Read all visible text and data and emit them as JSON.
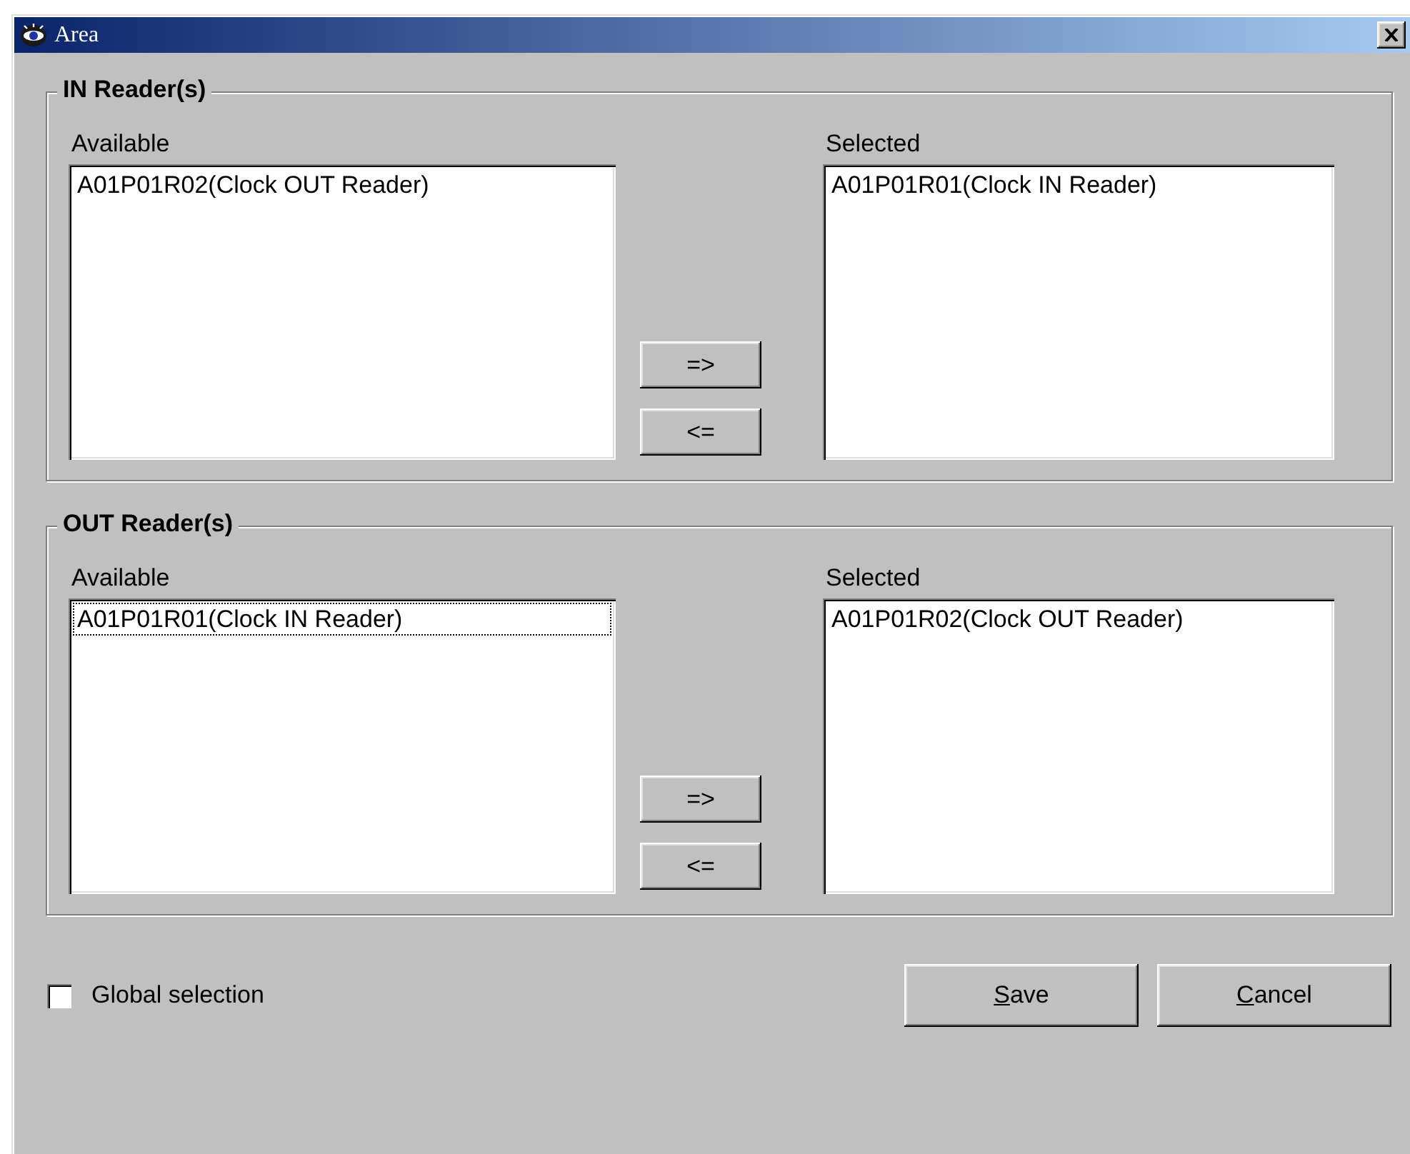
{
  "window": {
    "title": "Area"
  },
  "groups": [
    {
      "title": "IN Reader(s)",
      "available": {
        "label": "Available",
        "items": [
          {
            "text": "A01P01R02(Clock OUT Reader)",
            "focused": false
          }
        ]
      },
      "selected": {
        "label": "Selected",
        "items": [
          {
            "text": "A01P01R01(Clock IN Reader)",
            "focused": false
          }
        ]
      },
      "buttons": [
        "=>",
        "<="
      ]
    },
    {
      "title": "OUT Reader(s)",
      "available": {
        "label": "Available",
        "items": [
          {
            "text": "A01P01R01(Clock IN Reader)",
            "focused": true
          }
        ]
      },
      "selected": {
        "label": "Selected",
        "items": [
          {
            "text": "A01P01R02(Clock OUT Reader)",
            "focused": false
          }
        ]
      },
      "buttons": [
        "=>",
        "<="
      ]
    }
  ],
  "global_selection": {
    "label": "Global selection",
    "checked": false
  },
  "buttons": [
    {
      "mnemonic": "S",
      "rest": "ave"
    },
    {
      "mnemonic": "C",
      "rest": "ancel"
    }
  ]
}
